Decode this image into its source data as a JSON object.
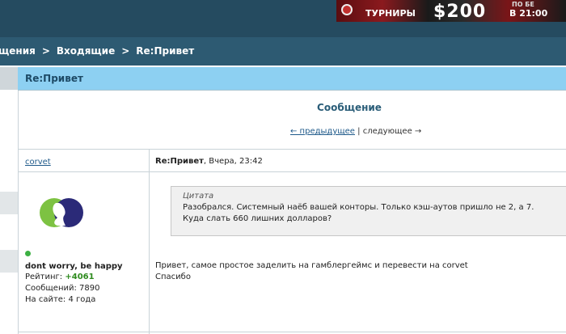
{
  "banner": {
    "line1": "",
    "tournaments": "ТУРНИРЫ",
    "amount": "$200",
    "line4": "ПО БЕ",
    "time": "В 21:00"
  },
  "breadcrumb": {
    "items": [
      "щения",
      "Входящие",
      "Re:Привет"
    ],
    "separator": ">"
  },
  "thread": {
    "title": "Re:Привет"
  },
  "message_header": {
    "heading": "Сообщение",
    "prev_label": "← предыдущее",
    "divider": "|",
    "next_label": "следующее →"
  },
  "post": {
    "author": "corvet",
    "subject": "Re:Привет",
    "date": ", Вчера, 23:42",
    "user": {
      "title": "dont worry, be happy",
      "rating_label": "Рейтинг:",
      "rating_value": "+4061",
      "posts": "Сообщений: 7890",
      "on_site": "На сайте: 4 года",
      "online_color": "#3cb043"
    },
    "quote": {
      "label": "Цитата",
      "lines": [
        "Разобрался. Системный наёб вашей конторы. Только кэш-аутов пришло не 2, а 7.",
        "Куда слать 660 лишних долларов?"
      ]
    },
    "body": [
      "Привет, самое простое заделить на гамблергеймс и перевести на corvet",
      "Спасибо"
    ]
  },
  "colors": {
    "header_bg": "#254b60",
    "breadcrumb_bg": "#2d5a72",
    "title_bar_bg": "#8dd0f2",
    "link": "#1f5a8a",
    "rating": "#2e8b1e"
  }
}
